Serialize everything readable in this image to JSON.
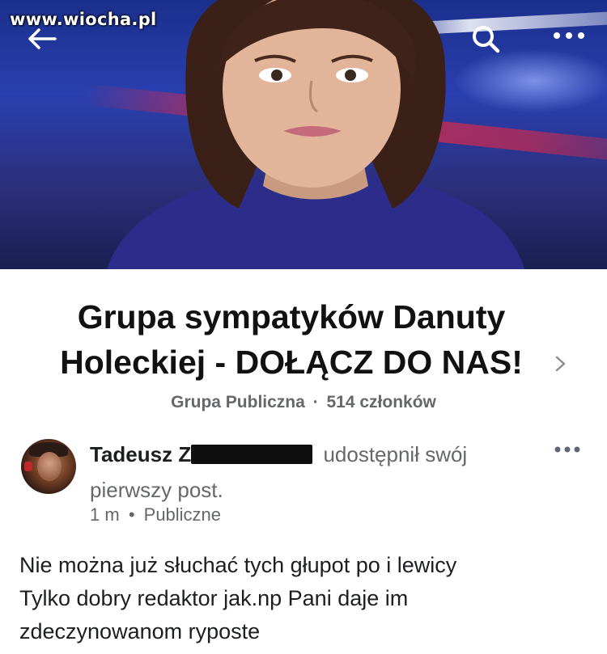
{
  "watermark": "www.wiocha.pl",
  "header": {
    "back_icon": "arrow-left-icon",
    "search_icon": "search-icon",
    "more_icon": "more-horizontal-icon"
  },
  "group": {
    "title_line1": "Grupa sympatyków Danuty",
    "title_line2": "Holeckiej - DOŁĄCZ DO NAS!",
    "privacy": "Grupa Publiczna",
    "separator": "·",
    "members": "514 członków"
  },
  "post": {
    "author_visible": "Tadeusz Z",
    "action_line1": "udostępnił swój",
    "action_line2": "pierwszy post.",
    "time": "1 m",
    "separator": "•",
    "visibility": "Publiczne",
    "body_line1": "Nie można już słuchać tych głupot po i lewicy",
    "body_line2": "Tylko dobry redaktor jak.np Pani daje im",
    "body_line3": "zdeczynowanom ryposte"
  },
  "colors": {
    "text_primary": "#1c1e21",
    "text_secondary": "#65676b",
    "cover_blue": "#2a3fb0"
  }
}
